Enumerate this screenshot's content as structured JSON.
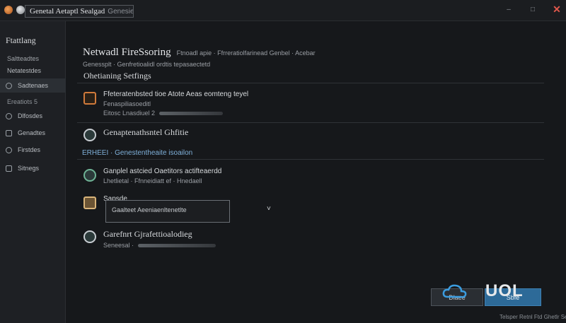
{
  "titlebar": {
    "title": "Genetal Aetaptl Sealgad",
    "subtitle": "Genesiels",
    "minimize": "–",
    "maximize": "□",
    "close": "✕"
  },
  "sidebar": {
    "title": "Ftattlang",
    "subtitle": "Saltteadtes",
    "subtitle2": "Netatestdes",
    "items": [
      {
        "label": "Sadtenaes",
        "icon": "network-icon"
      },
      {
        "label": "Dlfosdes",
        "icon": "shield-icon"
      },
      {
        "label": "Genadtes",
        "icon": "device-icon"
      },
      {
        "label": "Firstdes",
        "icon": "globe-icon"
      },
      {
        "label": "Sitnegs",
        "icon": "settings-icon"
      }
    ],
    "section": "Ereatiots 5"
  },
  "main": {
    "title": "Netwadl FireSsoring",
    "title_sub": "Ftnoadl apie · Ffrreratiolfarinead Genbel · Acebar",
    "description": "Genessplt · Genfretioalidl ordtis tepasaectetd",
    "section_title": "Ohetianing Setfings",
    "rows": [
      {
        "title": "Ffeteratenbsted tioe Atote Aeas eomteng teyel",
        "desc": "Fenaspiliasoeditl",
        "desc2": "Eitosc Lnasdiuel 2",
        "icon": "firewall-icon"
      },
      {
        "title": "Genaptenathsntel Ghfitie",
        "icon": "protection-icon"
      }
    ],
    "group_label": "ERHEEI · Genestentheaite isoailon",
    "row3": {
      "title": "Ganplel astcied Oaetitors actifteaerdd",
      "desc": "Lhetlietal · Ffnneidiatt ef · Hnedaell",
      "icon": "security-icon"
    },
    "dropdown": {
      "label": "Sapsde",
      "value": "Gaalteet Aeeniaenltenetlte",
      "icon": "profile-icon"
    },
    "row4": {
      "title": "Garefnrt Gjrafettioalodieg",
      "desc": "Seneesal ·",
      "icon": "gear-icon"
    }
  },
  "footer": {
    "cancel_label": "Dlaee",
    "apply_label": "Sbfe",
    "logo": "UOL",
    "note": "Telsper Retnl Ftd Ghetlr Senli"
  }
}
